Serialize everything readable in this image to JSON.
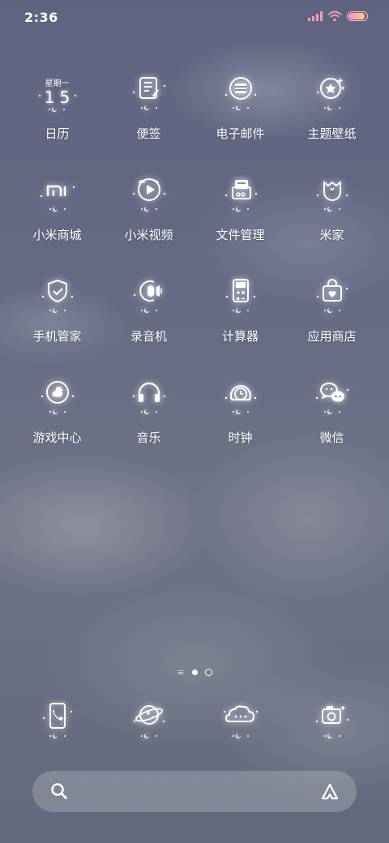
{
  "status_bar": {
    "time": "2:36"
  },
  "apps": [
    {
      "label": "日历",
      "icon": "calendar-icon",
      "day": "星期一",
      "date": "15"
    },
    {
      "label": "便签",
      "icon": "notes-icon"
    },
    {
      "label": "电子邮件",
      "icon": "email-icon"
    },
    {
      "label": "主题壁纸",
      "icon": "theme-icon"
    },
    {
      "label": "小米商城",
      "icon": "mi-store-icon"
    },
    {
      "label": "小米视频",
      "icon": "mi-video-icon"
    },
    {
      "label": "文件管理",
      "icon": "file-manager-icon"
    },
    {
      "label": "米家",
      "icon": "mijia-icon"
    },
    {
      "label": "手机管家",
      "icon": "security-icon"
    },
    {
      "label": "录音机",
      "icon": "recorder-icon"
    },
    {
      "label": "计算器",
      "icon": "calculator-icon"
    },
    {
      "label": "应用商店",
      "icon": "app-store-icon"
    },
    {
      "label": "游戏中心",
      "icon": "game-center-icon"
    },
    {
      "label": "音乐",
      "icon": "music-icon"
    },
    {
      "label": "时钟",
      "icon": "clock-icon"
    },
    {
      "label": "微信",
      "icon": "wechat-icon"
    }
  ],
  "dock": [
    {
      "icon": "phone-icon"
    },
    {
      "icon": "browser-icon"
    },
    {
      "icon": "messages-icon"
    },
    {
      "icon": "camera-icon"
    }
  ],
  "page_indicator": {
    "pages": 2,
    "current": 1
  },
  "search_bar": {
    "icon": "search-icon",
    "assistant_icon": "assistant-icon"
  },
  "colors": {
    "battery_start": "#ff8fb8",
    "battery_end": "#ffcf88",
    "signal": "#f0a0a8"
  },
  "battery_level": 0.9
}
